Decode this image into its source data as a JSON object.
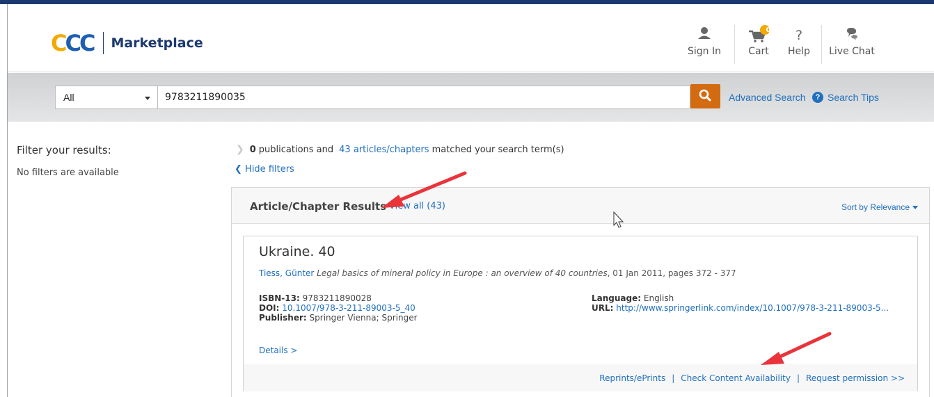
{
  "header": {
    "logo_letters": "CCC",
    "logo_text": "Marketplace",
    "nav": [
      {
        "label": "Sign In",
        "icon": "user-icon"
      },
      {
        "label": "Cart",
        "icon": "cart-icon",
        "badge": "0"
      },
      {
        "label": "Help",
        "icon": "help-icon"
      },
      {
        "label": "Live Chat",
        "icon": "chat-icon"
      }
    ]
  },
  "search": {
    "scope": "All",
    "query": "9783211890035",
    "advanced_label": "Advanced Search",
    "tips_label": "Search Tips"
  },
  "filters": {
    "title": "Filter your results:",
    "empty_text": "No filters are available"
  },
  "summary": {
    "pub_count": "0",
    "pub_text": "publications and",
    "article_count": "43",
    "article_link": "articles/chapters",
    "tail": "matched your search term(s)",
    "hide_filters": "Hide filters"
  },
  "results": {
    "title": "Article/Chapter Results",
    "view_all": "View all (43)",
    "sort_label": "Sort by Relevance"
  },
  "card": {
    "title": "Ukraine. 40",
    "author": "Tiess, Günter",
    "book": "Legal basics of mineral policy in Europe : an overview of 40 countries",
    "pub_info": ", 01 Jan 2011, pages 372 - 377",
    "isbn_label": "ISBN-13:",
    "isbn": "9783211890028",
    "doi_label": "DOI:",
    "doi": "10.1007/978-3-211-89003-5_40",
    "publisher_label": "Publisher:",
    "publisher": "Springer Vienna; Springer",
    "language_label": "Language:",
    "language": "English",
    "url_label": "URL:",
    "url": "http://www.springerlink.com/index/10.1007/978-3-211-89003-5...",
    "details": "Details >",
    "footer_links": [
      "Reprints/ePrints",
      "Check Content Availability",
      "Request permission >>"
    ],
    "separator": "|"
  },
  "colors": {
    "brand_navy": "#1d3a70",
    "brand_yellow": "#f2a900",
    "link_blue": "#1f6fbf",
    "search_orange": "#d36b10",
    "annotation_red": "#e8343a"
  }
}
